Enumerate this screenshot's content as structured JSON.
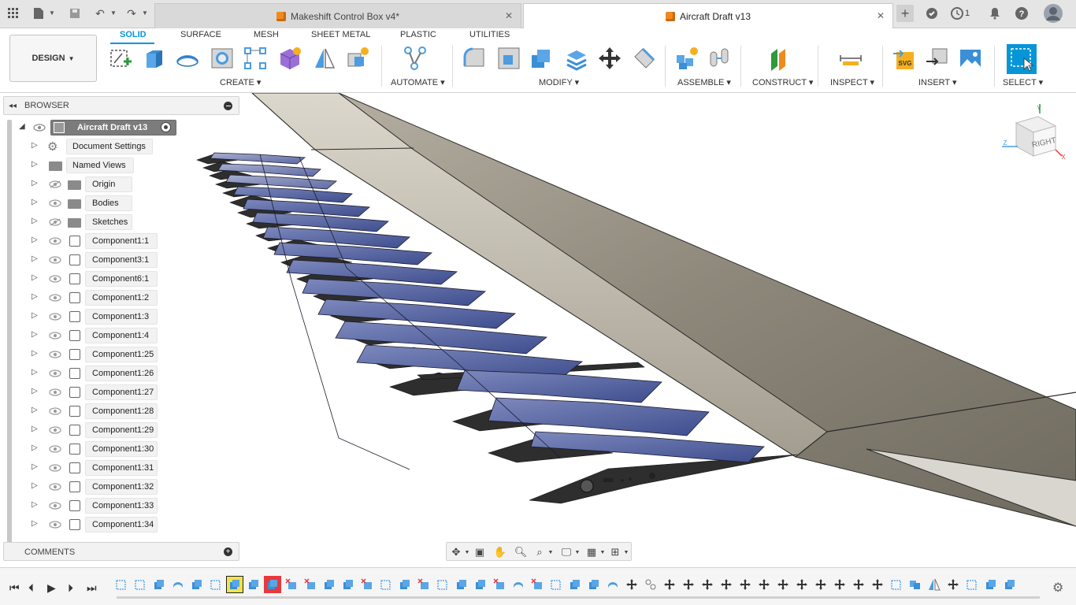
{
  "tabs": [
    {
      "label": "Makeshift Control Box v4*"
    },
    {
      "label": "Aircraft Draft v13"
    }
  ],
  "topbar": {
    "clock_count": "1"
  },
  "ribbon": {
    "workspace": "DESIGN",
    "workspace_tabs": [
      "SOLID",
      "SURFACE",
      "MESH",
      "SHEET METAL",
      "PLASTIC",
      "UTILITIES"
    ],
    "groups": [
      "CREATE",
      "AUTOMATE",
      "MODIFY",
      "ASSEMBLE",
      "CONSTRUCT",
      "INSPECT",
      "INSERT",
      "SELECT"
    ]
  },
  "browser": {
    "title": "BROWSER",
    "root": "Aircraft Draft v13",
    "items": [
      {
        "label": "Document Settings"
      },
      {
        "label": "Named Views"
      },
      {
        "label": "Origin"
      },
      {
        "label": "Bodies"
      },
      {
        "label": "Sketches"
      },
      {
        "label": "Component1:1"
      },
      {
        "label": "Component3:1"
      },
      {
        "label": "Component6:1"
      },
      {
        "label": "Component1:2"
      },
      {
        "label": "Component1:3"
      },
      {
        "label": "Component1:4"
      },
      {
        "label": "Component1:25"
      },
      {
        "label": "Component1:26"
      },
      {
        "label": "Component1:27"
      },
      {
        "label": "Component1:28"
      },
      {
        "label": "Component1:29"
      },
      {
        "label": "Component1:30"
      },
      {
        "label": "Component1:31"
      },
      {
        "label": "Component1:32"
      },
      {
        "label": "Component1:33"
      },
      {
        "label": "Component1:34"
      }
    ]
  },
  "comments": {
    "title": "COMMENTS"
  },
  "viewcube": {
    "face": "RIGHT",
    "axes": [
      "Y",
      "Z",
      "X"
    ]
  },
  "colors": {
    "accent": "#0696d7",
    "wing": "#8a8478",
    "solar_cell": "#4a5a96",
    "timeline_highlight": "#f0e34a",
    "timeline_error": "#e8383d"
  }
}
